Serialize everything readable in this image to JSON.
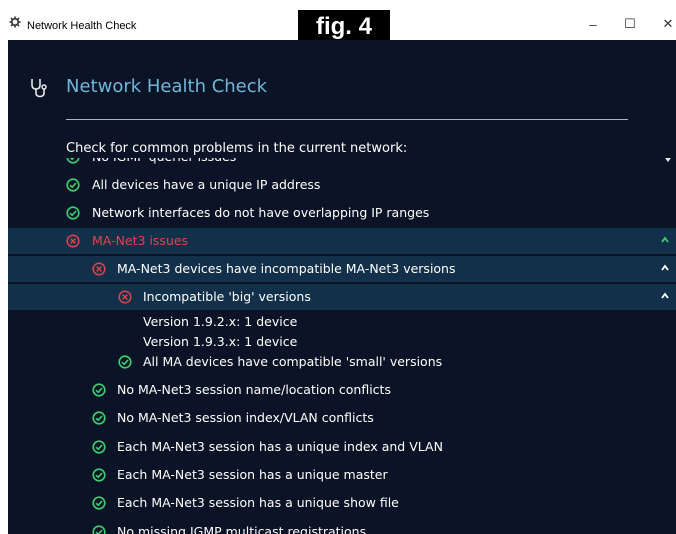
{
  "window": {
    "title": "Network Health Check",
    "fig_label": "fig. 4",
    "minimize": "–",
    "maximize": "☐",
    "close": "✕"
  },
  "header": {
    "title": "Network Health Check",
    "subtitle": "Check for common problems in the current network:"
  },
  "checks": {
    "partial_top": "No IGMP querier issues",
    "unique_ip": "All devices have a unique IP address",
    "no_overlap": "Network interfaces do not have overlapping IP ranges",
    "manet3_issues": "MA-Net3 issues",
    "incompatible_versions": "MA-Net3 devices have incompatible MA-Net3 versions",
    "incompatible_big": "Incompatible 'big' versions",
    "version_1": "Version 1.9.2.x: 1 device",
    "version_2": "Version 1.9.3.x: 1 device",
    "compatible_small": "All MA devices  have compatible 'small' versions",
    "no_name_conflicts": "No MA-Net3 session name/location conflicts",
    "no_index_conflicts": "No MA-Net3 session index/VLAN conflicts",
    "unique_index_vlan": "Each MA-Net3 session has a unique index and VLAN",
    "unique_master": "Each MA-Net3 session has a unique master",
    "unique_show": "Each MA-Net3 session has a unique show file",
    "partial_bottom": "No missing IGMP multicast registrations"
  },
  "colors": {
    "background": "#0b1426",
    "expanded_row": "#13304a",
    "ok": "#3ccf6e",
    "error": "#e0434a",
    "accent": "#6fb6d8"
  }
}
